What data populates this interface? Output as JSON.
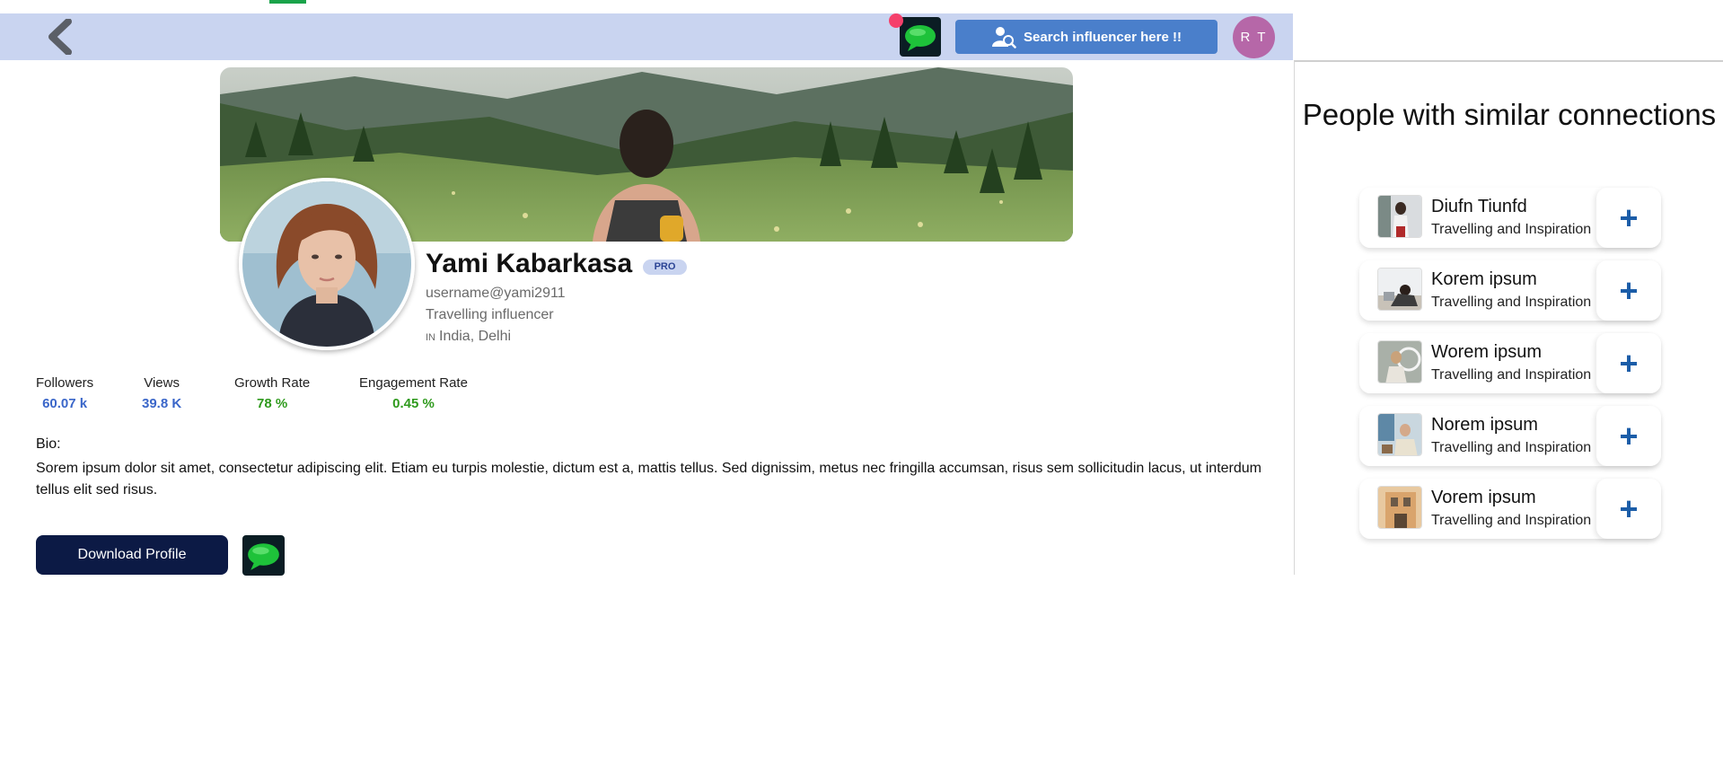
{
  "header": {
    "search_label": "Search influencer here !!",
    "avatar_initials": "R T"
  },
  "profile": {
    "name": "Yami Kabarkasa",
    "badge": "PRO",
    "username": "username@yami2911",
    "category": "Travelling influencer",
    "country_code": "IN",
    "location": "India, Delhi"
  },
  "stats": [
    {
      "label": "Followers",
      "value": "60.07 k",
      "color": "#3a66c9"
    },
    {
      "label": "Views",
      "value": "39.8 K",
      "color": "#3a66c9"
    },
    {
      "label": "Growth Rate",
      "value": "78 %",
      "color": "#2f9a1d"
    },
    {
      "label": "Engagement Rate",
      "value": "0.45 %",
      "color": "#2f9a1d"
    }
  ],
  "bio": {
    "label": "Bio:",
    "text": "Sorem ipsum dolor sit amet, consectetur adipiscing elit. Etiam eu turpis molestie, dictum est a, mattis tellus. Sed dignissim, metus nec fringilla accumsan, risus sem sollicitudin lacus, ut interdum tellus elit sed risus."
  },
  "actions": {
    "download_label": "Download Profile"
  },
  "similar": {
    "title": "People with similar connections",
    "add_symbol": "+",
    "people": [
      {
        "name": "Diufn Tiunfd",
        "subtitle": "Travelling and Inspiration"
      },
      {
        "name": "Korem ipsum",
        "subtitle": "Travelling and Inspiration"
      },
      {
        "name": "Worem ipsum",
        "subtitle": "Travelling and Inspiration"
      },
      {
        "name": "Norem ipsum",
        "subtitle": "Travelling and Inspiration"
      },
      {
        "name": "Vorem ipsum",
        "subtitle": "Travelling and Inspiration"
      }
    ]
  },
  "colors": {
    "header_bg": "#c9d4f0",
    "search_btn": "#4a7fcb",
    "avatar_bg": "#b667a8",
    "download_btn": "#0c1a45",
    "notification_dot": "#f5406b"
  },
  "icons": {
    "back": "chevron-left-icon",
    "chat": "chat-bubble-icon",
    "search_user": "user-search-icon",
    "add": "plus-icon"
  }
}
